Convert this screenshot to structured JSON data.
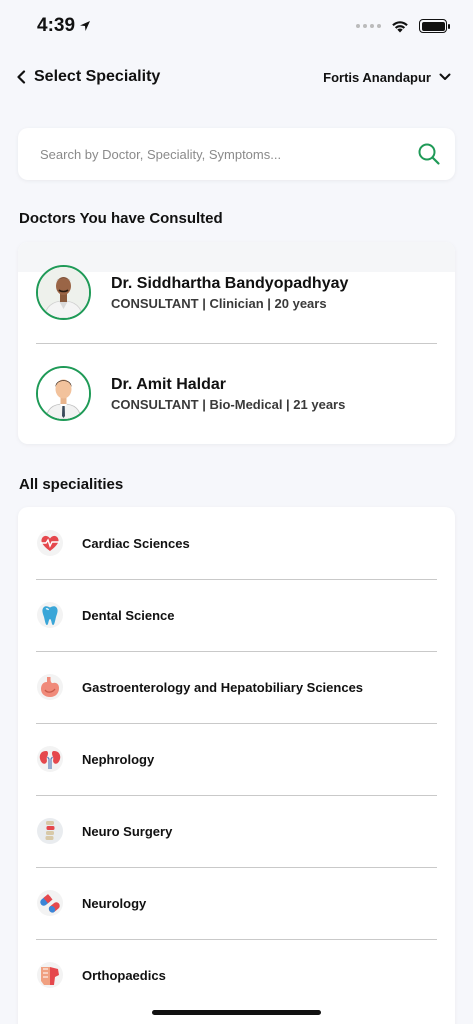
{
  "status_bar": {
    "time": "4:39"
  },
  "header": {
    "title": "Select Speciality",
    "location": "Fortis Anandapur"
  },
  "search": {
    "placeholder": "Search by Doctor, Speciality, Symptoms..."
  },
  "consulted": {
    "title": "Doctors You have Consulted",
    "doctors": [
      {
        "name": "Dr. Siddhartha Bandyopadhyay",
        "meta": "CONSULTANT | Clinician | 20 years"
      },
      {
        "name": "Dr. Amit Haldar",
        "meta": "CONSULTANT | Bio-Medical | 21 years"
      }
    ]
  },
  "specialities": {
    "title": "All specialities",
    "items": [
      {
        "label": "Cardiac Sciences",
        "icon": "heart-icon"
      },
      {
        "label": "Dental Science",
        "icon": "tooth-icon"
      },
      {
        "label": "Gastroenterology and Hepatobiliary Sciences",
        "icon": "stomach-icon"
      },
      {
        "label": "Nephrology",
        "icon": "kidney-icon"
      },
      {
        "label": "Neuro Surgery",
        "icon": "spine-icon"
      },
      {
        "label": "Neurology",
        "icon": "capsule-icon"
      },
      {
        "label": "Orthopaedics",
        "icon": "bone-icon"
      }
    ]
  },
  "colors": {
    "accent": "#1f9a57",
    "background": "#f6f7fb"
  }
}
